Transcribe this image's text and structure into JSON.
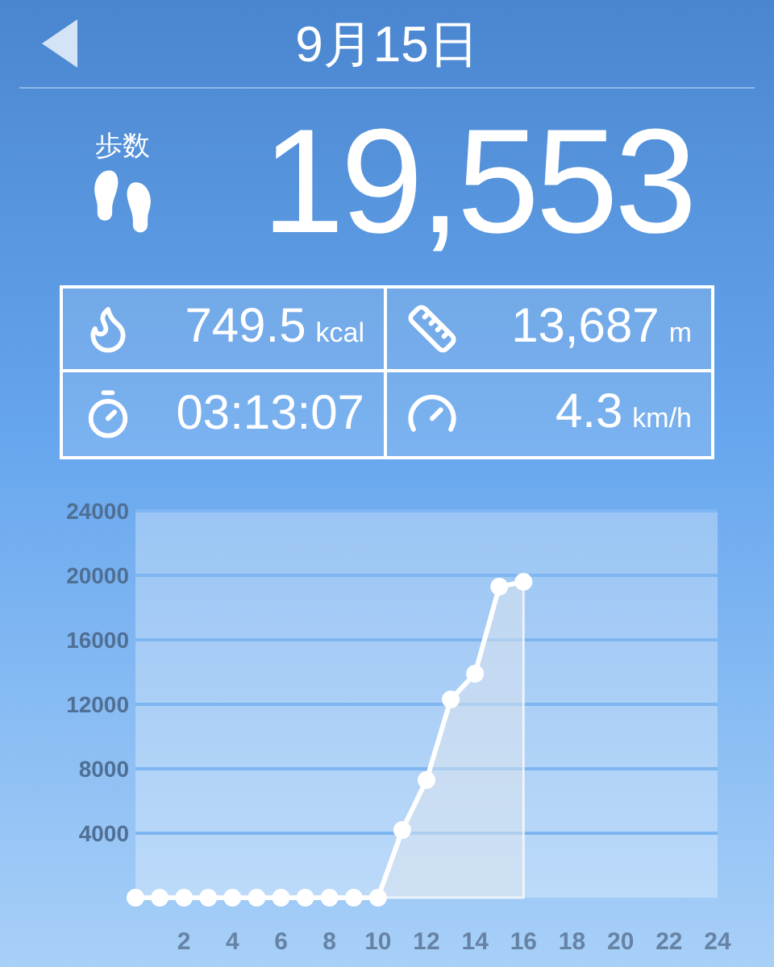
{
  "header": {
    "title": "9月15日"
  },
  "steps": {
    "label": "歩数",
    "value": "19,553"
  },
  "stats": [
    {
      "kind": "calories",
      "value": "749.5",
      "unit": "kcal"
    },
    {
      "kind": "distance",
      "value": "13,687",
      "unit": "m"
    },
    {
      "kind": "duration",
      "value": "03:13:07"
    },
    {
      "kind": "speed",
      "value": "4.3",
      "unit": "km/h"
    }
  ],
  "chart": {
    "chart_data": {
      "type": "area",
      "x": [
        0,
        1,
        2,
        3,
        4,
        5,
        6,
        7,
        8,
        9,
        10,
        11,
        12,
        13,
        14,
        15,
        16
      ],
      "grid": true,
      "series": [
        {
          "color": "#ffffff",
          "values": [
            0,
            0,
            0,
            0,
            0,
            0,
            0,
            0,
            0,
            0,
            0,
            4200,
            7300,
            12300,
            13900,
            19300,
            19600
          ]
        }
      ],
      "xlim": [
        0,
        24
      ],
      "ylim": [
        0,
        24000
      ],
      "xticks": [
        2,
        4,
        6,
        8,
        10,
        12,
        14,
        16,
        18,
        20,
        22,
        24
      ],
      "yticks": [
        4000,
        8000,
        12000,
        16000,
        20000,
        24000
      ]
    }
  }
}
